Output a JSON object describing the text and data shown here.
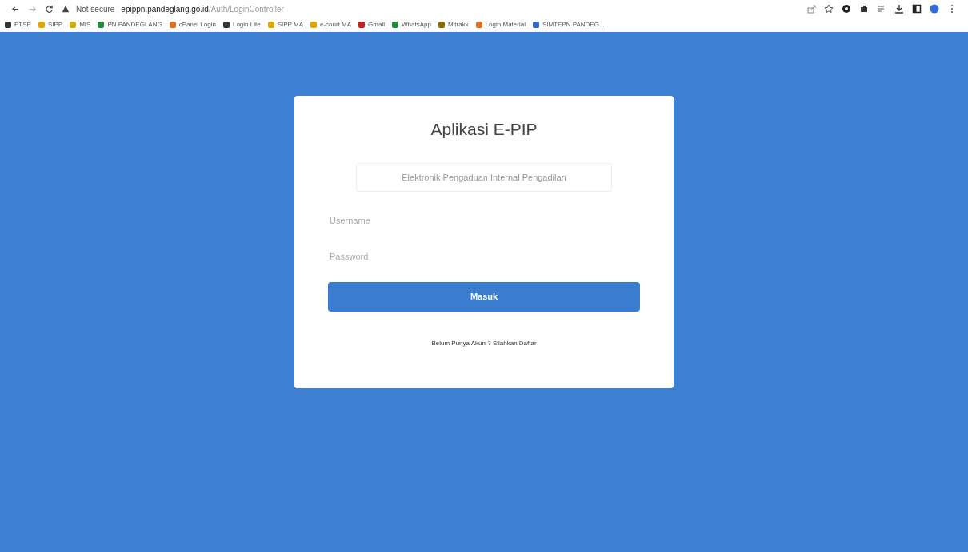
{
  "browser": {
    "security": "Not secure",
    "url_host": "epippn.pandeglang.go.id",
    "url_path": "/Auth/LoginController"
  },
  "bookmarks": [
    {
      "label": "PTSP",
      "color": "#333333"
    },
    {
      "label": "SIPP",
      "color": "#e0a800"
    },
    {
      "label": "MIS",
      "color": "#d4b000"
    },
    {
      "label": "PN PANDEGLANG",
      "color": "#1e8a3a"
    },
    {
      "label": "cPanel Login",
      "color": "#e07020"
    },
    {
      "label": "Login Lite",
      "color": "#333333"
    },
    {
      "label": "SIPP MA",
      "color": "#e0a800"
    },
    {
      "label": "e-court MA",
      "color": "#e0a800"
    },
    {
      "label": "Gmail",
      "color": "#c5221f"
    },
    {
      "label": "WhatsApp",
      "color": "#1e8a3a"
    },
    {
      "label": "Mitrakk",
      "color": "#8a6d00"
    },
    {
      "label": "Login Material",
      "color": "#e07020"
    },
    {
      "label": "SIMTEPN PANDEG...",
      "color": "#3366cc"
    }
  ],
  "login": {
    "title": "Aplikasi E-PIP",
    "subtitle": "Elektronik Pengaduan Internal Pengadilan",
    "username": {
      "placeholder": "Username"
    },
    "password": {
      "placeholder": "Password"
    },
    "submit": "Masuk",
    "register": "Belum Punya Akun ? Silahkan Daftar"
  }
}
